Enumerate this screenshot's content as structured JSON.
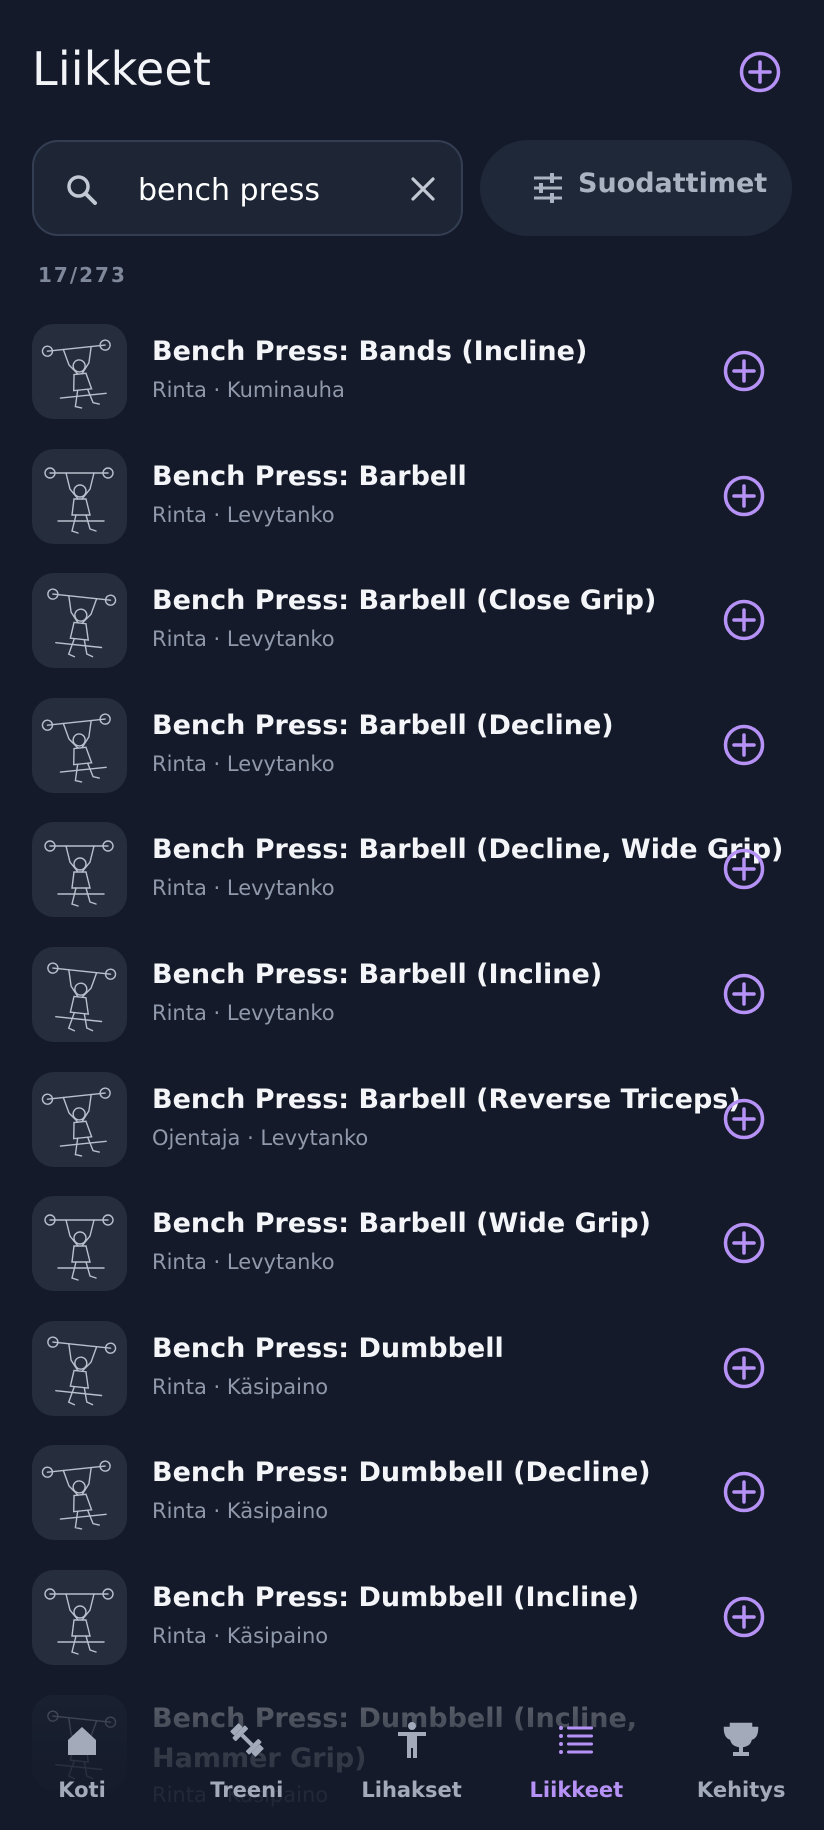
{
  "header": {
    "title": "Liikkeet",
    "add_icon": "add-circle-icon"
  },
  "search": {
    "value": "bench press",
    "placeholder": "",
    "icon": "search-icon",
    "clear_icon": "close-icon"
  },
  "filter": {
    "label": "Suodattimet",
    "icon": "tune-icon"
  },
  "result_count": "17/273",
  "colors": {
    "background": "#141a29",
    "accent": "#b692f6",
    "card": "#262e3d"
  },
  "exercises": [
    {
      "name": "Bench Press: Bands (Incline)",
      "meta": "Rinta · Kuminauha"
    },
    {
      "name": "Bench Press: Barbell",
      "meta": "Rinta · Levytanko"
    },
    {
      "name": "Bench Press: Barbell (Close Grip)",
      "meta": "Rinta · Levytanko"
    },
    {
      "name": "Bench Press: Barbell (Decline)",
      "meta": "Rinta · Levytanko"
    },
    {
      "name": "Bench Press: Barbell (Decline, Wide Grip)",
      "meta": "Rinta · Levytanko"
    },
    {
      "name": "Bench Press: Barbell (Incline)",
      "meta": "Rinta · Levytanko"
    },
    {
      "name": "Bench Press: Barbell (Reverse Triceps)",
      "meta": "Ojentaja · Levytanko"
    },
    {
      "name": "Bench Press: Barbell (Wide Grip)",
      "meta": "Rinta · Levytanko"
    },
    {
      "name": "Bench Press: Dumbbell",
      "meta": "Rinta · Käsipaino"
    },
    {
      "name": "Bench Press: Dumbbell (Decline)",
      "meta": "Rinta · Käsipaino"
    },
    {
      "name": "Bench Press: Dumbbell (Incline)",
      "meta": "Rinta · Käsipaino"
    },
    {
      "name": "Bench Press: Dumbbell (Incline, Hammer Grip)",
      "meta": "Rinta · Käsipaino"
    }
  ],
  "nav": [
    {
      "label": "Koti",
      "icon": "home-icon",
      "active": false
    },
    {
      "label": "Treeni",
      "icon": "dumbbell-icon",
      "active": false
    },
    {
      "label": "Lihakset",
      "icon": "person-icon",
      "active": false
    },
    {
      "label": "Liikkeet",
      "icon": "list-icon",
      "active": true
    },
    {
      "label": "Kehitys",
      "icon": "trophy-icon",
      "active": false
    }
  ]
}
